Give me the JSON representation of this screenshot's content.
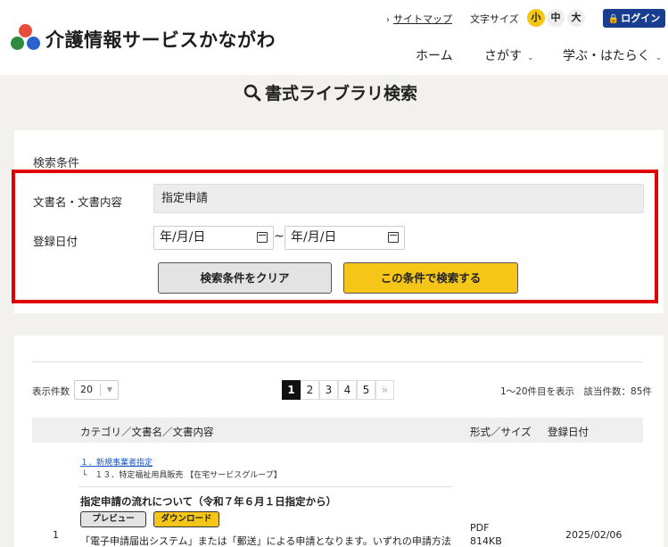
{
  "header": {
    "site_title": "介護情報サービスかながわ",
    "sitemap_label": "サイトマップ",
    "fontsize_label": "文字サイズ",
    "fontsize_options": [
      "小",
      "中",
      "大"
    ],
    "fontsize_selected": "小",
    "login_label": "ログイン",
    "nav": [
      {
        "label": "ホーム"
      },
      {
        "label": "さがす"
      },
      {
        "label": "学ぶ・はたらく"
      }
    ]
  },
  "page": {
    "title": "書式ライブラリ検索"
  },
  "search": {
    "heading": "検索条件",
    "doc_label": "文書名・文書内容",
    "doc_value": "指定申請",
    "date_label": "登録日付",
    "date_from_placeholder": "年/月/日",
    "date_to_placeholder": "年/月/日",
    "range_sep": "~",
    "clear_button": "検索条件をクリア",
    "search_button": "この条件で検索する"
  },
  "results": {
    "perpage_label": "表示件数",
    "perpage_value": "20",
    "pages": [
      "1",
      "2",
      "3",
      "4",
      "5",
      "»"
    ],
    "current_page": "1",
    "count_text": "1〜20件目を表示　該当件数：85件",
    "columns": [
      "カテゴリ／文書名／文書内容",
      "形式／サイズ",
      "登録日付"
    ],
    "rows": [
      {
        "num": "1",
        "category": "１．新規事業者指定",
        "subcategory": "└　１３．特定福祉用具販売 【在宅サービスグループ】",
        "title": "指定申請の流れについて（令和７年６月１日指定から）",
        "preview_label": "プレビュー",
        "download_label": "ダウンロード",
        "description": "「電子申請届出システム」または「郵送」による申請となります。いずれの申請方法",
        "format": "PDF",
        "size": "814KB",
        "date": "2025/02/06"
      }
    ]
  },
  "colors": {
    "accent_yellow": "#f5c518",
    "login_blue": "#1a3e8f",
    "highlight_red": "#e00000",
    "link_blue": "#1a56c8"
  }
}
